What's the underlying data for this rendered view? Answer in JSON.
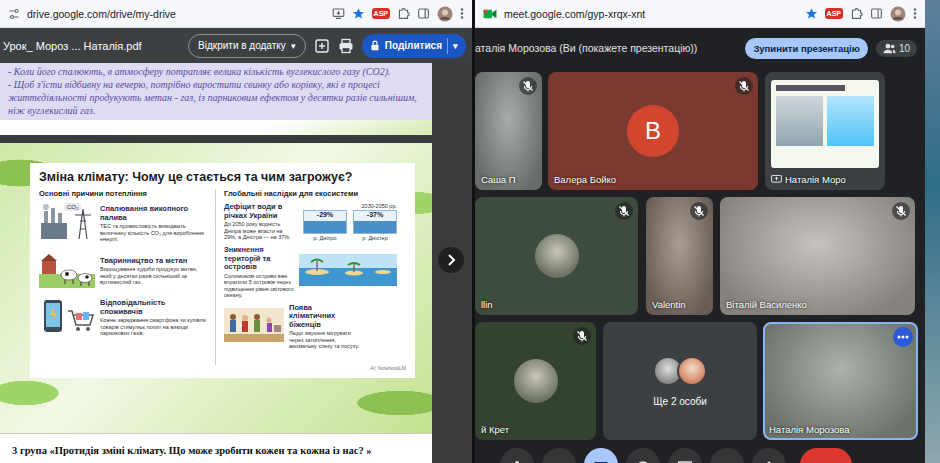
{
  "left_window": {
    "address_bar": {
      "url": "drive.google.com/drive/my-drive",
      "badge": "ASP"
    },
    "viewer": {
      "file_name": "Урок_ Мороз ... Наталія.pdf",
      "open_with": "Відкрити в додатку",
      "open_with_caret": "▾",
      "share": "Поділитися",
      "share_caret": "▾"
    },
    "page_text": [
      "- Коли його спалюють, в атмосферу потрапляє велика кількість вуглекислого газу (СО2).",
      "- Щоб з'їсти відбивну на вечерю, потрібно виростити свинку або корівку, які в процесі життєдіяльності продукують метан - газ, із парниковим ефектом у десятки разів сильнішим, ніж вуглекислий газ."
    ],
    "infographic": {
      "title": "Зміна клімату: Чому це стається та чим загрожує?",
      "causes": {
        "heading": "Основні причини потепління",
        "items": [
          {
            "kind": "factory",
            "title": "Спалювання викопного палива",
            "text": "ТЕС та промисловість викидають величезну кількість CO₂ для вироблення енергії.",
            "icon_label": "CO₂"
          },
          {
            "kind": "cows",
            "title": "Тваринництво та метан",
            "text": "Вирощування худоби продукує метан, який у десятки разів сильніший за вуглекислий газ."
          },
          {
            "kind": "phone",
            "title": "Відповідальність споживачів",
            "text": "Кожне заряджання смартфона чи купівля товарів стимулює попит на викиди парникових газів."
          }
        ]
      },
      "effects": {
        "heading": "Глобальні наслідки для екосистеми",
        "items": [
          {
            "kind": "rivers",
            "title": "Дефіцит води в річках України",
            "text": "До 2050 року водність Дніпра може впасти на 29%, а Дністра — на 37%.",
            "period": "2030-2050 рр.",
            "bars": [
              {
                "value": "-29%",
                "label": "р. Дніпро"
              },
              {
                "value": "-37%",
                "label": "р. Дністер"
              }
            ]
          },
          {
            "kind": "islands",
            "title": "Зникнення територій та островів",
            "text": "Соломонові острови вже втратили 5 островів через підвищення рівня світового океану."
          },
          {
            "kind": "refugees",
            "title": "Поява кліматичних біженців",
            "text": "Люди змушені мігрувати через затоплення, аномальну спеку та посуху."
          }
        ]
      },
      "credit": "AI: NotebookLM"
    },
    "next_heading": "3 група «Протидія зміні клімату. Що може зробити кожен та кожна із нас? »"
  },
  "right_window": {
    "address_bar": {
      "url": "meet.google.com/gyp-xrqx-xnt",
      "badge": "ASP"
    },
    "presenter_label": "аталія Морозова (Ви (покажете презентацію))",
    "stop_button": "Зупинити презентацію",
    "participants_count": "10",
    "tiles": [
      {
        "name": "Саша П",
        "kind": "video",
        "muted": true,
        "highlighted": false,
        "color": "#8b918d"
      },
      {
        "name": "Валера Бойко",
        "kind": "letter",
        "initial": "В",
        "muted": true,
        "highlighted": false,
        "color": "#7a3a30"
      },
      {
        "name": "Наталія Моро",
        "kind": "presentation",
        "muted": false,
        "highlighted": false,
        "color": "#3c4043"
      },
      {
        "name": "llin",
        "kind": "photo-avatar",
        "muted": true,
        "highlighted": false,
        "color": "#3e4c3d"
      },
      {
        "name": "Valentin",
        "kind": "video",
        "muted": true,
        "highlighted": false,
        "color": "#8a7c70"
      },
      {
        "name": "Віталій Василенко",
        "kind": "video",
        "muted": true,
        "highlighted": false,
        "color": "#b3aea8"
      },
      {
        "name": "й Крет",
        "kind": "photo-avatar",
        "muted": true,
        "highlighted": false,
        "color": "#33432f"
      },
      {
        "name": "Ще 2 особи",
        "kind": "more",
        "muted": false,
        "highlighted": false,
        "color": "#3c4043"
      },
      {
        "name": "Наталія Морозова",
        "kind": "video",
        "muted": false,
        "highlighted": true,
        "color": "#8e988f"
      }
    ],
    "toolbar": [
      {
        "kind": "mic",
        "selected": false
      },
      {
        "kind": "camera",
        "selected": false
      },
      {
        "kind": "captions",
        "selected": true
      },
      {
        "kind": "emoji",
        "selected": false
      },
      {
        "kind": "present",
        "selected": false
      },
      {
        "kind": "raise-hand",
        "selected": false
      },
      {
        "kind": "more",
        "selected": false
      },
      {
        "kind": "hangup",
        "selected": false
      }
    ]
  }
}
